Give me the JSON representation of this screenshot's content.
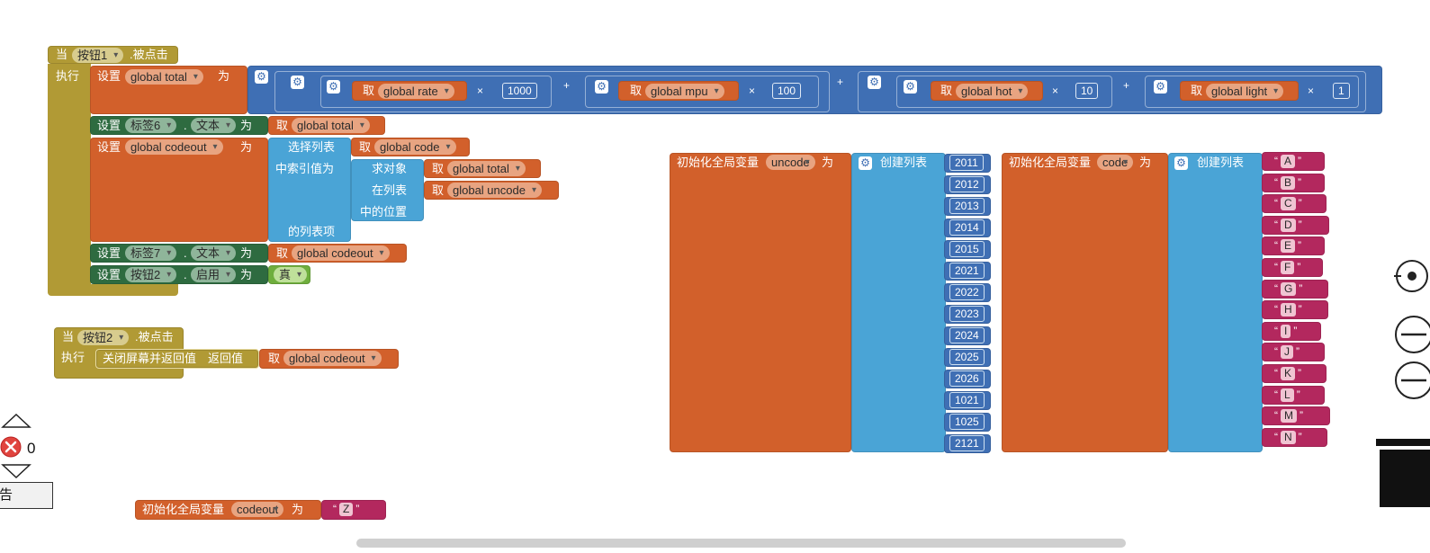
{
  "event1": {
    "when": "当",
    "component": "按钮1",
    "event": ".被点击",
    "do": "执行",
    "set": "设置",
    "to": "为",
    "get": "取",
    "dot": ".",
    "var_total": "global total",
    "var_rate": "global rate",
    "val_1000": "1000",
    "var_mpu": "global mpu",
    "val_100": "100",
    "var_hot": "global hot",
    "val_10": "10",
    "var_light": "global light",
    "val_1": "1",
    "times": "×",
    "plus": "+",
    "label6": "标签6",
    "text_prop": "文本",
    "var_codeout": "global codeout",
    "select_list": "选择列表",
    "var_code": "global code",
    "index_is": "中索引值为",
    "find_obj": "求对象",
    "in_list": "在列表",
    "var_uncode": "global uncode",
    "position": "中的位置",
    "list_item": "的列表项",
    "label7": "标签7",
    "button2": "按钮2",
    "enabled_prop": "启用",
    "true_val": "真"
  },
  "event2": {
    "when": "当",
    "component": "按钮2",
    "event": ".被点击",
    "do": "执行",
    "close_screen": "关闭屏幕并返回值",
    "return_value": "返回值",
    "get": "取",
    "var_codeout": "global codeout"
  },
  "init_uncode": {
    "label": "初始化全局变量",
    "name": "uncode",
    "to": "为",
    "create_list": "创建列表",
    "items": [
      "2011",
      "2012",
      "2013",
      "2014",
      "2015",
      "2021",
      "2022",
      "2023",
      "2024",
      "2025",
      "2026",
      "1021",
      "1025",
      "2121"
    ]
  },
  "init_code": {
    "label": "初始化全局变量",
    "name": "code",
    "to": "为",
    "create_list": "创建列表",
    "items": [
      "A",
      "B",
      "C",
      "D",
      "E",
      "F",
      "G",
      "H",
      "I",
      "J",
      "K",
      "L",
      "M",
      "N"
    ]
  },
  "init_codeout": {
    "label": "初始化全局变量",
    "name": "codeout",
    "to": "为",
    "value": "Z"
  },
  "warnings": {
    "error_count": "0",
    "partial_label": "告"
  },
  "quote_open": "“",
  "quote_close": "”",
  "colors": {
    "event": "#b19a35",
    "variable": "#d2602b",
    "component": "#2e6b40",
    "list": "#4aa4d6",
    "math": "#3f6fb4",
    "text": "#b3285e",
    "logic": "#6fae3d"
  }
}
